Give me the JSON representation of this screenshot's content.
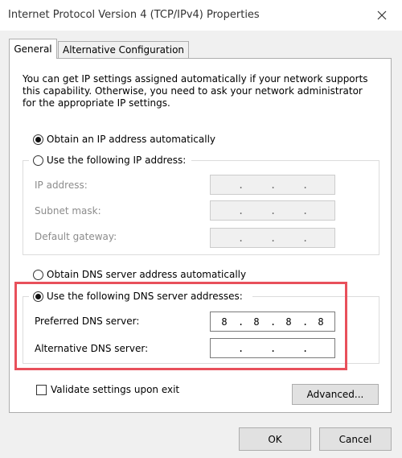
{
  "window": {
    "title": "Internet Protocol Version 4 (TCP/IPv4) Properties",
    "close_glyph": "✕"
  },
  "tabs": [
    {
      "label": "General",
      "selected": true
    },
    {
      "label": "Alternative Configuration",
      "selected": false
    }
  ],
  "general": {
    "intro_lines": [
      "You can get IP settings assigned automatically if your network supports",
      "this capability. Otherwise, you need to ask your network administrator",
      "for the appropriate IP settings."
    ],
    "ip_mode": {
      "auto_label": "Obtain an IP address automatically",
      "manual_label": "Use the following IP address:",
      "selected": "auto"
    },
    "ip_fields": [
      {
        "label": "IP address:",
        "octets": [
          "",
          "",
          "",
          ""
        ]
      },
      {
        "label": "Subnet mask:",
        "octets": [
          "",
          "",
          "",
          ""
        ]
      },
      {
        "label": "Default gateway:",
        "octets": [
          "",
          "",
          "",
          ""
        ]
      }
    ],
    "dns_mode": {
      "auto_label": "Obtain DNS server address automatically",
      "manual_label": "Use the following DNS server addresses:",
      "selected": "manual"
    },
    "dns_fields": [
      {
        "label": "Preferred DNS server:",
        "octets": [
          "8",
          "8",
          "8",
          "8"
        ]
      },
      {
        "label": "Alternative DNS server:",
        "octets": [
          "",
          "",
          "",
          ""
        ]
      }
    ],
    "validate_label": "Validate settings upon exit",
    "validate_checked": false,
    "advanced_label": "Advanced..."
  },
  "footer": {
    "ok_label": "OK",
    "cancel_label": "Cancel"
  },
  "colors": {
    "highlight": "#e8505b"
  }
}
